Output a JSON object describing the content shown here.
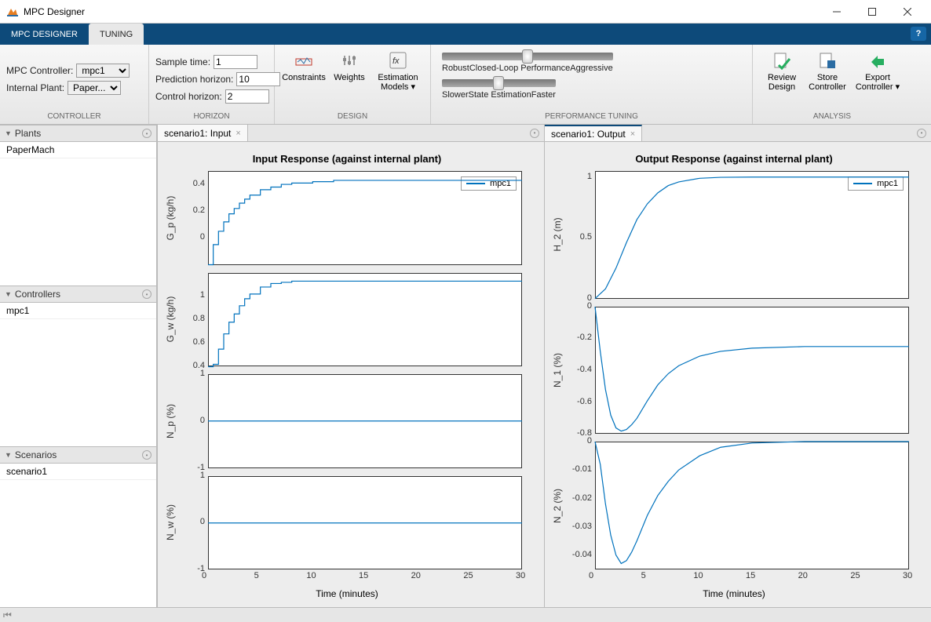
{
  "window": {
    "title": "MPC Designer"
  },
  "tabs": {
    "designer": "MPC DESIGNER",
    "tuning": "TUNING"
  },
  "controller_group": {
    "label": "CONTROLLER",
    "mpc_controller_label": "MPC Controller:",
    "mpc_controller_value": "mpc1",
    "internal_plant_label": "Internal Plant:",
    "internal_plant_value": "Paper..."
  },
  "horizon_group": {
    "label": "HORIZON",
    "sample_time_label": "Sample time:",
    "sample_time_value": "1",
    "prediction_horizon_label": "Prediction horizon:",
    "prediction_horizon_value": "10",
    "control_horizon_label": "Control horizon:",
    "control_horizon_value": "2"
  },
  "design_group": {
    "label": "DESIGN",
    "constraints": "Constraints",
    "weights": "Weights",
    "estimation_models": "Estimation Models ▾"
  },
  "perf_group": {
    "label": "PERFORMANCE TUNING",
    "clp_left": "Robust",
    "clp_center": "Closed-Loop Performance",
    "clp_right": "Aggressive",
    "se_left": "Slower",
    "se_center": "State Estimation",
    "se_right": "Faster",
    "clp_pos": 50,
    "se_pos": 50
  },
  "analysis_group": {
    "label": "ANALYSIS",
    "review": "Review Design",
    "store": "Store Controller",
    "export": "Export Controller ▾"
  },
  "panels": {
    "plants": {
      "title": "Plants",
      "items": [
        "PaperMach"
      ]
    },
    "controllers": {
      "title": "Controllers",
      "items": [
        "mpc1"
      ]
    },
    "scenarios": {
      "title": "Scenarios",
      "items": [
        "scenario1"
      ]
    }
  },
  "docs": {
    "input_tab": "scenario1: Input",
    "output_tab": "scenario1: Output"
  },
  "charts": {
    "input_title": "Input Response (against internal plant)",
    "output_title": "Output Response (against internal plant)",
    "xlabel": "Time (minutes)",
    "legend": "mpc1",
    "x_ticks": [
      0,
      5,
      10,
      15,
      20,
      25,
      30
    ]
  },
  "chart_data": [
    {
      "type": "line",
      "title": "Input Response — G_p",
      "x": [
        0,
        0.5,
        1,
        1.5,
        2,
        2.5,
        3,
        3.5,
        4,
        5,
        6,
        7,
        8,
        10,
        12,
        15,
        20,
        30
      ],
      "y": [
        -0.2,
        -0.05,
        0.05,
        0.12,
        0.18,
        0.22,
        0.26,
        0.29,
        0.32,
        0.36,
        0.38,
        0.4,
        0.41,
        0.42,
        0.43,
        0.43,
        0.43,
        0.43
      ],
      "ylabel": "G_p  (kg/h)",
      "ylim": [
        -0.2,
        0.5
      ],
      "y_ticks": [
        0,
        0.2,
        0.4
      ],
      "stepped": true
    },
    {
      "type": "line",
      "title": "Input Response — G_w",
      "x": [
        0,
        0.5,
        1,
        1.5,
        2,
        2.5,
        3,
        3.5,
        4,
        5,
        6,
        7,
        8,
        10,
        12,
        15,
        20,
        30
      ],
      "y": [
        0.4,
        0.42,
        0.55,
        0.68,
        0.78,
        0.85,
        0.92,
        0.98,
        1.02,
        1.08,
        1.11,
        1.12,
        1.13,
        1.13,
        1.13,
        1.13,
        1.13,
        1.13
      ],
      "ylabel": "G_w  (kg/h)",
      "ylim": [
        0.4,
        1.2
      ],
      "y_ticks": [
        0.4,
        0.6,
        0.8,
        1
      ],
      "stepped": true
    },
    {
      "type": "line",
      "title": "Input Response — N_p",
      "x": [
        0,
        30
      ],
      "y": [
        0,
        0
      ],
      "ylabel": "N_p  (%)",
      "ylim": [
        -1,
        1
      ],
      "y_ticks": [
        -1,
        0,
        1
      ],
      "stepped": false
    },
    {
      "type": "line",
      "title": "Input Response — N_w",
      "x": [
        0,
        30
      ],
      "y": [
        0,
        0
      ],
      "ylabel": "N_w  (%)",
      "ylim": [
        -1,
        1
      ],
      "y_ticks": [
        -1,
        0,
        1
      ],
      "stepped": false
    },
    {
      "type": "line",
      "title": "Output Response — H_2",
      "x": [
        0,
        1,
        2,
        3,
        4,
        5,
        6,
        7,
        8,
        10,
        12,
        15,
        20,
        25,
        30
      ],
      "y": [
        0,
        0.08,
        0.25,
        0.46,
        0.65,
        0.78,
        0.87,
        0.93,
        0.96,
        0.99,
        0.998,
        1.0,
        1.0,
        1.0,
        1.0
      ],
      "ylabel": "H_2  (m)",
      "ylim": [
        0,
        1.05
      ],
      "y_ticks": [
        0,
        0.5,
        1
      ],
      "stepped": false
    },
    {
      "type": "line",
      "title": "Output Response — N_1",
      "x": [
        0,
        0.5,
        1,
        1.5,
        2,
        2.5,
        3,
        3.5,
        4,
        5,
        6,
        7,
        8,
        10,
        12,
        15,
        20,
        25,
        30
      ],
      "y": [
        0,
        -0.28,
        -0.52,
        -0.68,
        -0.76,
        -0.78,
        -0.77,
        -0.74,
        -0.7,
        -0.59,
        -0.49,
        -0.42,
        -0.37,
        -0.31,
        -0.28,
        -0.26,
        -0.25,
        -0.25,
        -0.25
      ],
      "ylabel": "N_1  (%)",
      "ylim": [
        -0.8,
        0
      ],
      "y_ticks": [
        -0.8,
        -0.6,
        -0.4,
        -0.2,
        0
      ],
      "stepped": false
    },
    {
      "type": "line",
      "title": "Output Response — N_2",
      "x": [
        0,
        0.5,
        1,
        1.5,
        2,
        2.5,
        3,
        3.5,
        4,
        5,
        6,
        7,
        8,
        10,
        12,
        15,
        20,
        25,
        30
      ],
      "y": [
        0,
        -0.008,
        -0.022,
        -0.033,
        -0.04,
        -0.043,
        -0.042,
        -0.039,
        -0.035,
        -0.026,
        -0.019,
        -0.014,
        -0.01,
        -0.005,
        -0.002,
        -0.0005,
        0,
        0,
        0
      ],
      "ylabel": "N_2  (%)",
      "ylim": [
        -0.045,
        0
      ],
      "y_ticks": [
        -0.04,
        -0.03,
        -0.02,
        -0.01,
        0
      ],
      "stepped": false
    }
  ]
}
